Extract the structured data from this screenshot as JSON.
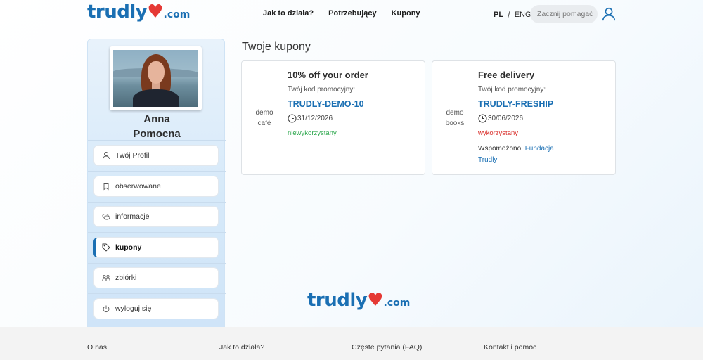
{
  "header": {
    "logo": {
      "word": "trudly",
      "heart": "♥",
      "suffix": ".com"
    },
    "nav": [
      "Jak to działa?",
      "Potrzebujący",
      "Kupony"
    ],
    "languages": {
      "pl": "PL",
      "separator": "/",
      "en": "ENG"
    },
    "search_placeholder": "Zacznij pomagać",
    "user_icon": "user-icon"
  },
  "sidebar": {
    "user_first_name": "Anna",
    "user_last_name": "Pomocna",
    "items": [
      {
        "label": "Twój Profil",
        "icon": "user-icon"
      },
      {
        "label": "obserwowane",
        "icon": "bookmark-icon"
      },
      {
        "label": "informacje",
        "icon": "messages-icon"
      },
      {
        "label": "kupony",
        "icon": "tag-icon",
        "active": true
      },
      {
        "label": "zbiórki",
        "icon": "people-icon"
      },
      {
        "label": "wyloguj się",
        "icon": "power-icon"
      }
    ]
  },
  "main": {
    "title": "Twoje kupony",
    "coupons": [
      {
        "shop_line1": "demo",
        "shop_line2": "café",
        "title": "10% off your order",
        "code_label": "Twój kod promocyjny:",
        "code": "TRUDLY-DEMO-10",
        "expiry": "31/12/2026",
        "status": "niewykorzystany"
      },
      {
        "shop_line1": "demo",
        "shop_line2": "books",
        "title": "Free delivery",
        "code_label": "Twój kod promocyjny:",
        "code": "TRUDLY-FRESHIP",
        "expiry": "30/06/2026",
        "status": "wykorzystany",
        "supported_label": "Wspomożono:",
        "supported_org_line1": "Fundacja",
        "supported_org_line2": "Trudly"
      }
    ]
  },
  "footer": {
    "links": [
      "O nas",
      "Jak to działa?",
      "Częste pytania (FAQ)",
      "Kontakt i pomoc"
    ]
  },
  "colors": {
    "brand_blue": "#1a6fb3",
    "heart_red": "#e53935",
    "status_green": "#2fa84f",
    "status_red": "#d9302c"
  }
}
